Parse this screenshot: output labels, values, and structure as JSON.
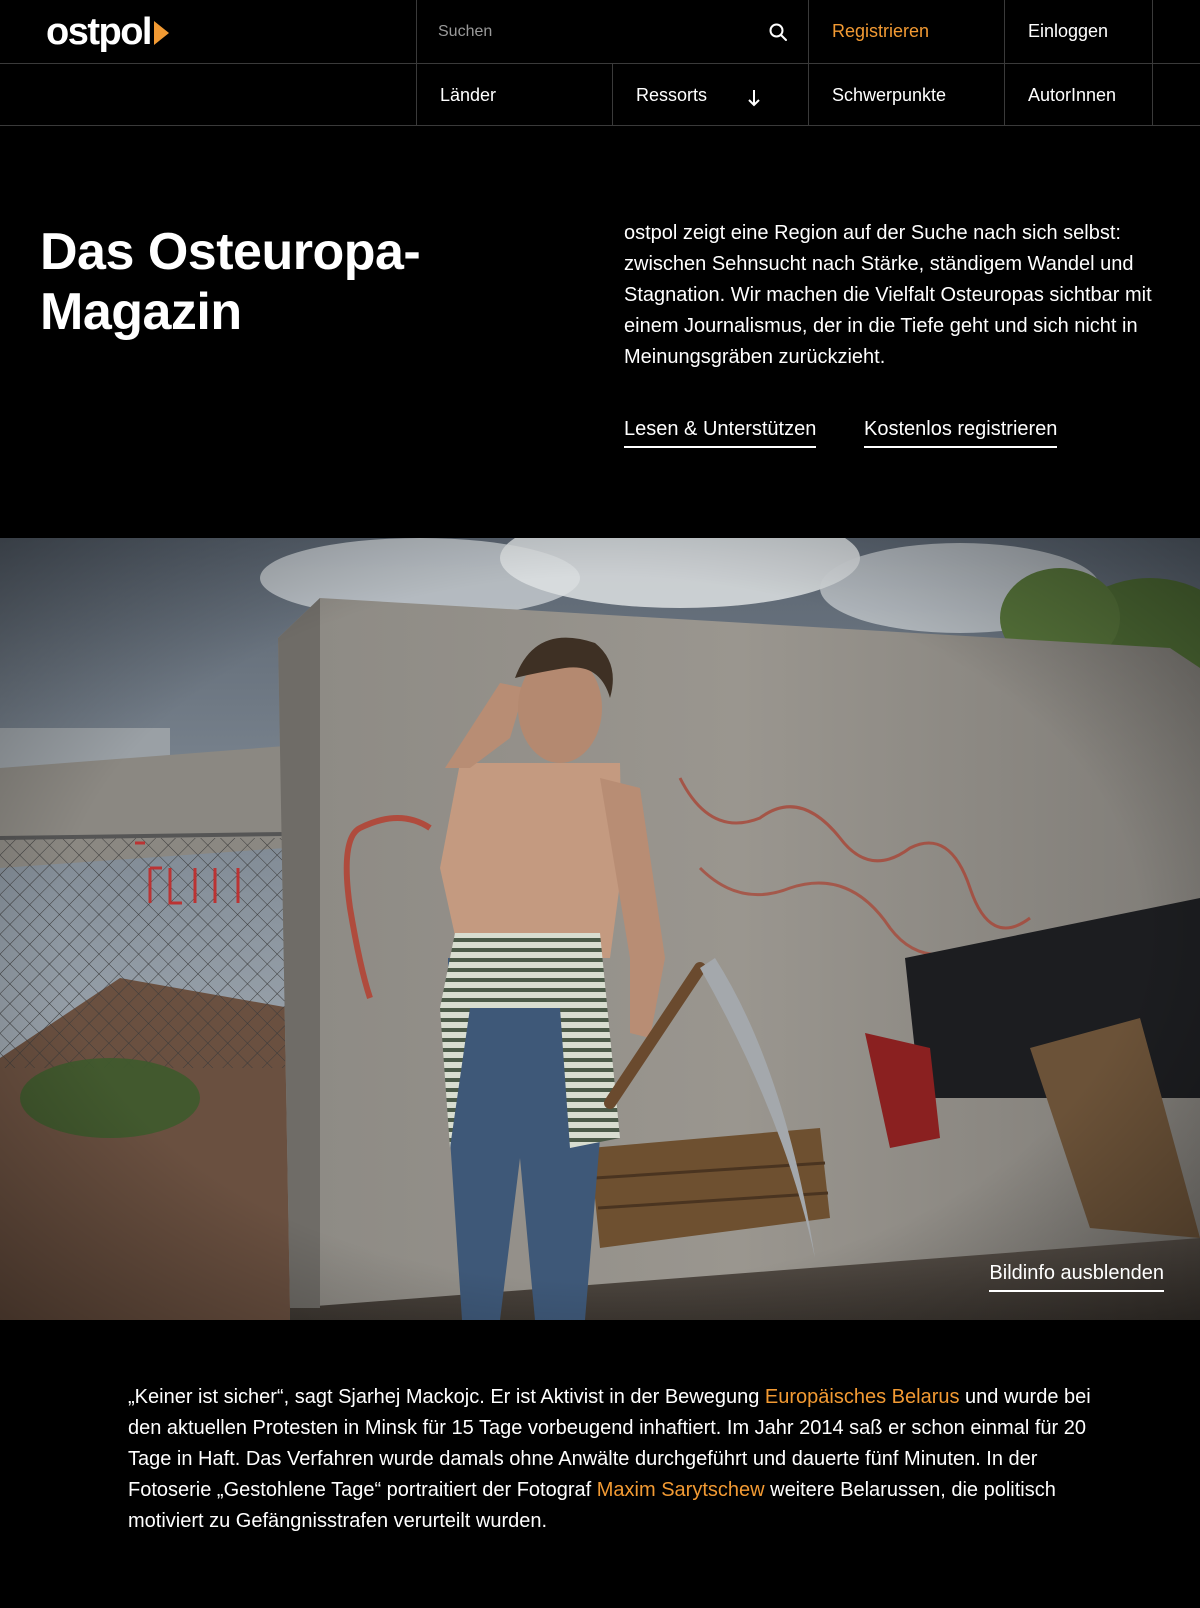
{
  "header": {
    "logo_text": "ostpol",
    "search_placeholder": "Suchen",
    "register_label": "Registrieren",
    "login_label": "Einloggen",
    "nav": {
      "countries": "Länder",
      "ressorts": "Ressorts",
      "focus": "Schwerpunkte",
      "authors": "AutorInnen"
    },
    "accent_color": "#f29a33"
  },
  "hero": {
    "title": "Das Osteuropa-Magazin",
    "intro": "ostpol zeigt eine Region auf der Suche nach sich selbst: zwischen Sehnsucht nach Stärke, ständigem Wandel und Stagnation. Wir machen die Vielfalt Osteuropas sichtbar mit einem Journalismus, der in die Tiefe geht und sich nicht in Meinungsgräben zurückzieht.",
    "cta_support": "Lesen & Unterstützen",
    "cta_register": "Kostenlos registrieren"
  },
  "photo": {
    "toggle_label": "Bildinfo ausblenden"
  },
  "caption": {
    "part1": "„Keiner ist sicher“, sagt Sjarhej Mackojc. Er ist Aktivist in der Bewegung ",
    "link1": "Europäisches Belarus",
    "part2": " und wurde bei den aktuellen Protesten in Minsk für 15 Tage vorbeugend inhaftiert. Im Jahr 2014 saß er schon einmal für 20 Tage in Haft. Das Verfahren wurde damals ohne Anwälte durchgeführt und dauerte fünf Minuten. In der Fotoserie „Gestohlene Tage“ portraitiert der  Fotograf ",
    "link2": "Maxim Sarytschew",
    "part3": " weitere Belarussen, die politisch motiviert zu Gefängnisstrafen verurteilt wurden."
  }
}
